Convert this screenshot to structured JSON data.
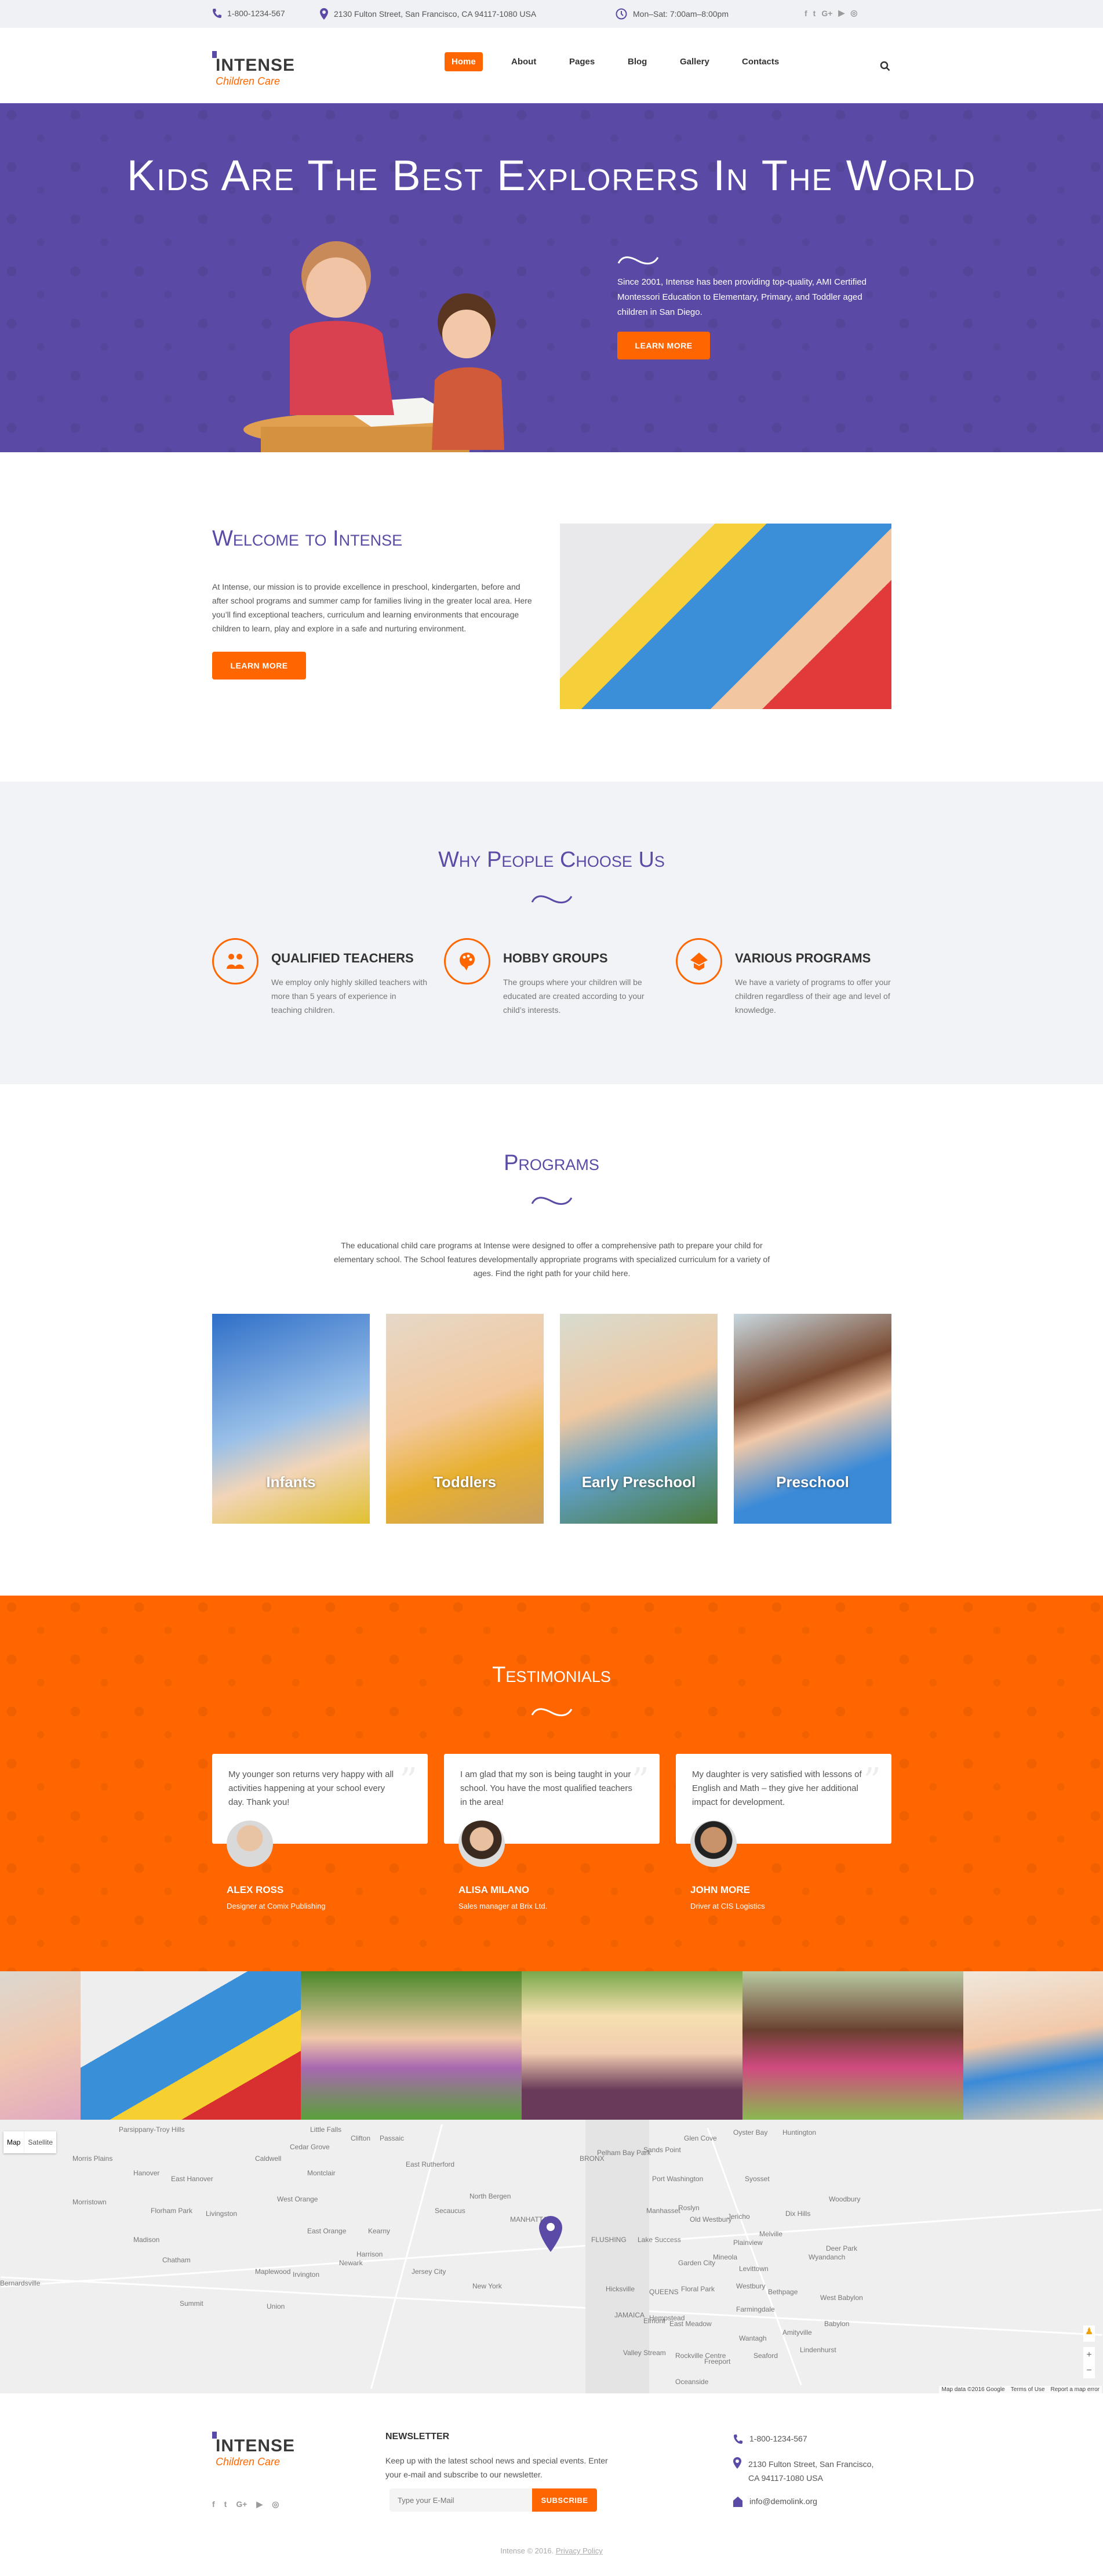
{
  "colors": {
    "brand_purple": "#5b4ba6",
    "accent_orange": "#ff6600",
    "section_bg": "#f2f3f7"
  },
  "topbar": {
    "phone": "1-800-1234-567",
    "address": "2130 Fulton Street, San Francisco, CA 94117-1080 USA",
    "hours": "Mon–Sat: 7:00am–8:00pm",
    "social": [
      {
        "icon": "facebook-icon",
        "glyph": "f"
      },
      {
        "icon": "twitter-icon",
        "glyph": "t"
      },
      {
        "icon": "google-plus-icon",
        "glyph": "G+"
      },
      {
        "icon": "youtube-icon",
        "glyph": "▶"
      },
      {
        "icon": "instagram-icon",
        "glyph": "◎"
      }
    ]
  },
  "header": {
    "logo_name": "INTENSE",
    "logo_sub": "Children Care",
    "nav": [
      "Home",
      "About",
      "Pages",
      "Blog",
      "Gallery",
      "Contacts"
    ],
    "active": "Home"
  },
  "hero": {
    "title": "Kids Are The Best Explorers In The World",
    "text": "Since 2001, Intense has been providing top-quality, AMI Certified Montessori Education to Elementary, Primary, and Toddler aged children in San Diego.",
    "button": "LEARN MORE"
  },
  "welcome": {
    "title": "Welcome to Intense",
    "text": "At Intense, our mission is to provide excellence in preschool, kindergarten, before and after school programs and summer camp for families living in the greater local area. Here you’ll find exceptional teachers, curriculum and learning environments that encourage children to learn, play and explore in a safe and nurturing environment.",
    "button": "LEARN MORE"
  },
  "why": {
    "title": "Why People Choose Us",
    "features": [
      {
        "icon": "teachers-icon",
        "title": "QUALIFIED TEACHERS",
        "text": "We employ only highly skilled teachers with more than 5 years of experience in teaching children."
      },
      {
        "icon": "palette-icon",
        "title": "HOBBY GROUPS",
        "text": "The groups where your children will be educated are created according to your child’s interests."
      },
      {
        "icon": "graduation-icon",
        "title": "VARIOUS PROGRAMS",
        "text": "We have a variety of programs to offer your children regardless of their age and level of knowledge."
      }
    ]
  },
  "programs": {
    "title": "Programs",
    "text": "The educational child care programs at Intense were designed to offer a comprehensive path to prepare your child for elementary school. The School features developmentally appropriate programs with specialized curriculum for a variety of ages. Find the right path for your child here.",
    "items": [
      "Infants",
      "Toddlers",
      "Early Preschool",
      "Preschool"
    ]
  },
  "testimonials": {
    "title": "Testimonials",
    "items": [
      {
        "text": "My younger son returns very happy with all activities happening at your school every day. Thank you!",
        "name": "ALEX ROSS",
        "role": "Designer at Comix Publishing"
      },
      {
        "text": "I am glad that my son is being taught in your school. You have the most qualified teachers in the area!",
        "name": "ALISA MILANO",
        "role": "Sales manager at Brix Ltd."
      },
      {
        "text": "My daughter is very satisfied with lessons of English and Math – they give her additional impact for development.",
        "name": "JOHN MORE",
        "role": "Driver at CIS Logistics"
      }
    ]
  },
  "map": {
    "type_buttons": [
      "Map",
      "Satellite"
    ],
    "attribution": "Map data ©2016 Google",
    "terms": "Terms of Use",
    "report": "Report a map error",
    "zoom_in": "+",
    "zoom_out": "−",
    "places": [
      "Parsippany-Troy Hills",
      "Little Falls",
      "Clifton",
      "Passaic",
      "Cedar Grove",
      "Morris Plains",
      "Caldwell",
      "East Rutherford",
      "Hanover",
      "East Hanover",
      "Montclair",
      "Morristown",
      "West Orange",
      "North Bergen",
      "Florham Park",
      "Livingston",
      "Secaucus",
      "MANHATTAN",
      "East Orange",
      "Kearny",
      "Madison",
      "Harrison",
      "Newark",
      "Jersey City",
      "New York",
      "Chatham",
      "Maplewood",
      "Irvington",
      "Summit",
      "Union",
      "Bernardsville",
      "BRONX",
      "Pelham Bay Park",
      "Glen Cove",
      "Oyster Bay",
      "Huntington",
      "Sands Point",
      "Port Washington",
      "Manhasset",
      "Roslyn",
      "Old Westbury",
      "Jericho",
      "Syosset",
      "Woodbury",
      "Dix Hills",
      "Melville",
      "Plainview",
      "Hicksville",
      "QUEENS",
      "Floral Park",
      "Garden City",
      "Mineola",
      "Westbury",
      "Levittown",
      "Bethpage",
      "Farmingdale",
      "Hempstead",
      "East Meadow",
      "Elmont",
      "Valley Stream",
      "Rockville Centre",
      "Freeport",
      "Wantagh",
      "Seaford",
      "Amityville",
      "Lindenhurst",
      "Babylon",
      "West Babylon",
      "Deer Park",
      "Wyandanch",
      "Oceanside",
      "JAMAICA",
      "FLUSHING",
      "Lake Success"
    ]
  },
  "footer": {
    "logo_name": "INTENSE",
    "logo_sub": "Children Care",
    "newsletter_title": "NEWSLETTER",
    "newsletter_text": "Keep up with the latest school news and special events. Enter your e-mail and subscribe to our newsletter.",
    "email_placeholder": "Type your E-Mail",
    "subscribe": "SUBSCRIBE",
    "phone": "1-800-1234-567",
    "address": "2130 Fulton Street, San Francisco, CA 94117-1080 USA",
    "email": "info@demolink.org",
    "copyright": "Intense © 2016.",
    "privacy": "Privacy Policy"
  }
}
